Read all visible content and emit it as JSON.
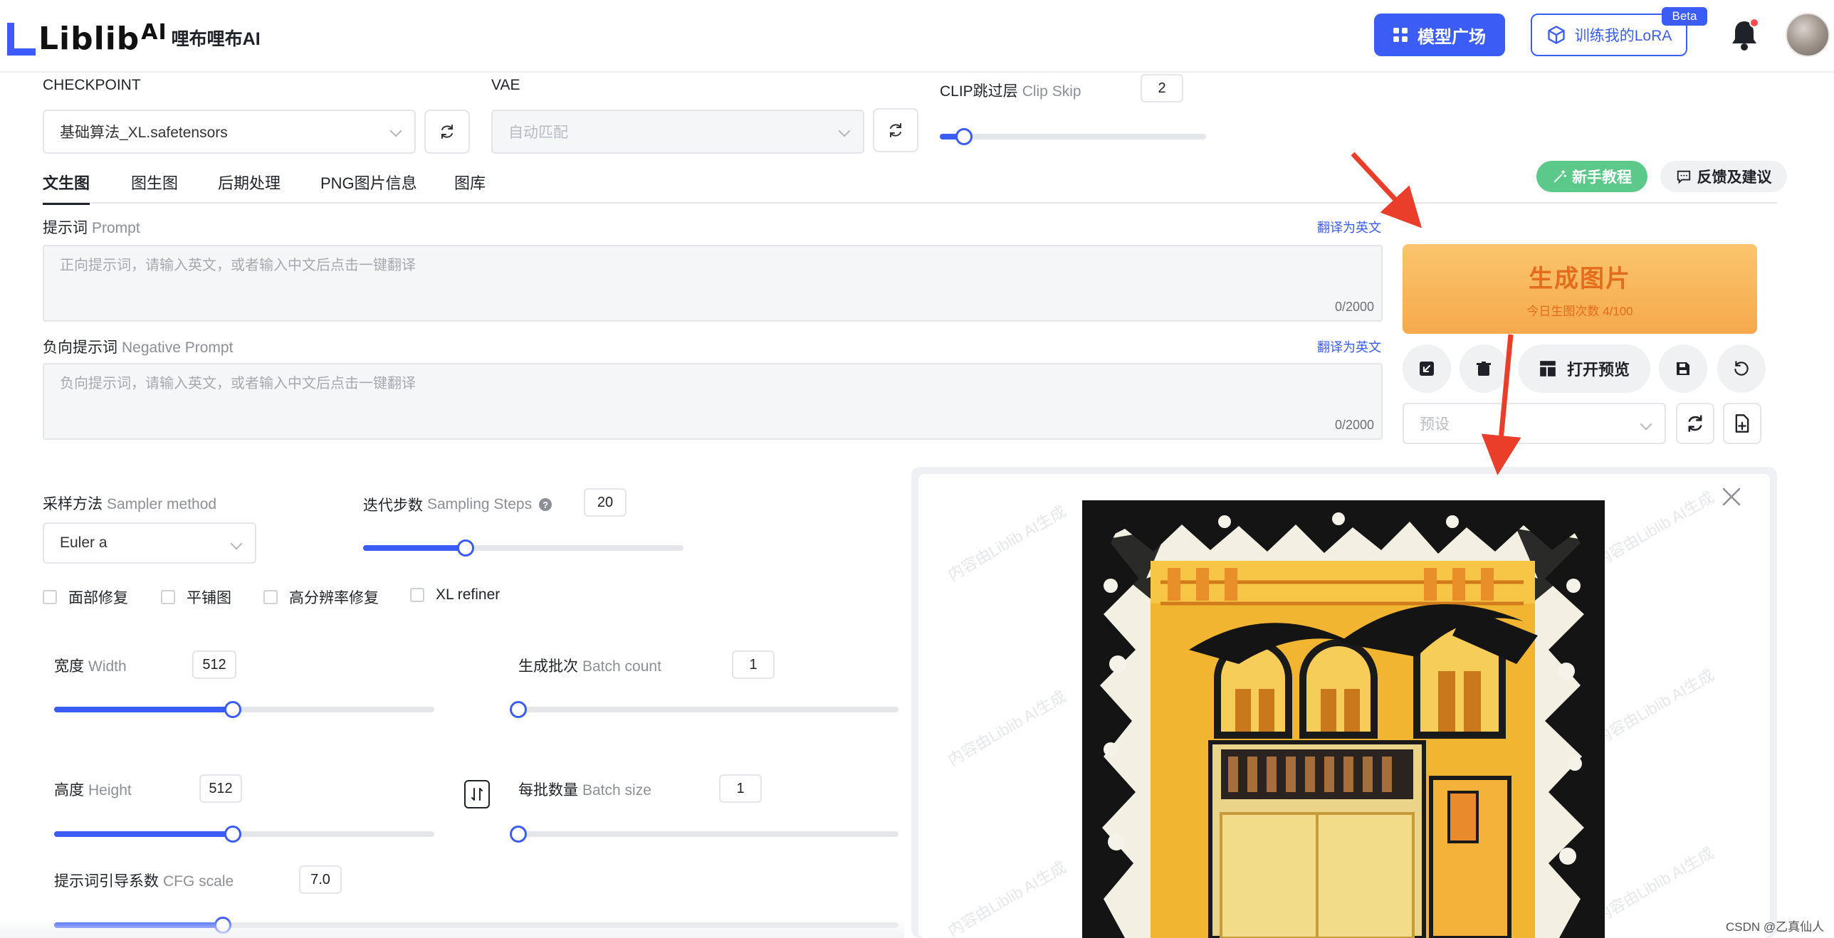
{
  "header": {
    "logo_text": "Liblib",
    "logo_ai": "AI",
    "logo_cn": "哩布哩布AI",
    "model_square": "模型广场",
    "train_lora": "训练我的LoRA",
    "beta": "Beta"
  },
  "checkpoint": {
    "label": "CHECKPOINT",
    "value": "基础算法_XL.safetensors"
  },
  "vae": {
    "label": "VAE",
    "value": "自动匹配"
  },
  "clip": {
    "label": "CLIP跳过层",
    "label_en": "Clip Skip",
    "value": "2",
    "fraction": 0.09
  },
  "tabs": [
    "文生图",
    "图生图",
    "后期处理",
    "PNG图片信息",
    "图库"
  ],
  "tutorial": "新手教程",
  "feedback": "反馈及建议",
  "prompt": {
    "label": "提示词",
    "label_en": "Prompt",
    "translate": "翻译为英文",
    "placeholder": "正向提示词，请输入英文，或者输入中文后点击一键翻译",
    "counter": "0/2000"
  },
  "negative": {
    "label": "负向提示词",
    "label_en": "Negative Prompt",
    "translate": "翻译为英文",
    "placeholder": "负向提示词，请输入英文，或者输入中文后点击一键翻译",
    "counter": "0/2000"
  },
  "generate": {
    "title": "生成图片",
    "sub": "今日生图次数 4/100"
  },
  "open_preview": "打开预览",
  "preset": {
    "placeholder": "预设"
  },
  "sampler": {
    "label": "采样方法",
    "label_en": "Sampler method",
    "value": "Euler a"
  },
  "steps": {
    "label": "迭代步数",
    "label_en": "Sampling Steps",
    "value": "20",
    "fraction": 0.32
  },
  "options": [
    "面部修复",
    "平铺图",
    "高分辨率修复",
    "XL refiner"
  ],
  "width": {
    "label": "宽度",
    "label_en": "Width",
    "value": "512",
    "fraction": 0.47
  },
  "batch_count": {
    "label": "生成批次",
    "label_en": "Batch count",
    "value": "1",
    "fraction": 0.0
  },
  "height": {
    "label": "高度",
    "label_en": "Height",
    "value": "512",
    "fraction": 0.47
  },
  "batch_size": {
    "label": "每批数量",
    "label_en": "Batch size",
    "value": "1",
    "fraction": 0.0
  },
  "cfg": {
    "label": "提示词引导系数",
    "label_en": "CFG scale",
    "value": "7.0",
    "fraction": 0.2
  },
  "watermark": "内容由Liblib AI生成",
  "footnote": "CSDN @乙真仙人",
  "colors": {
    "accent": "#3b5cf5",
    "orange": "#f6a94c",
    "green": "#5cc98a",
    "arrow": "#ea3e2b"
  }
}
